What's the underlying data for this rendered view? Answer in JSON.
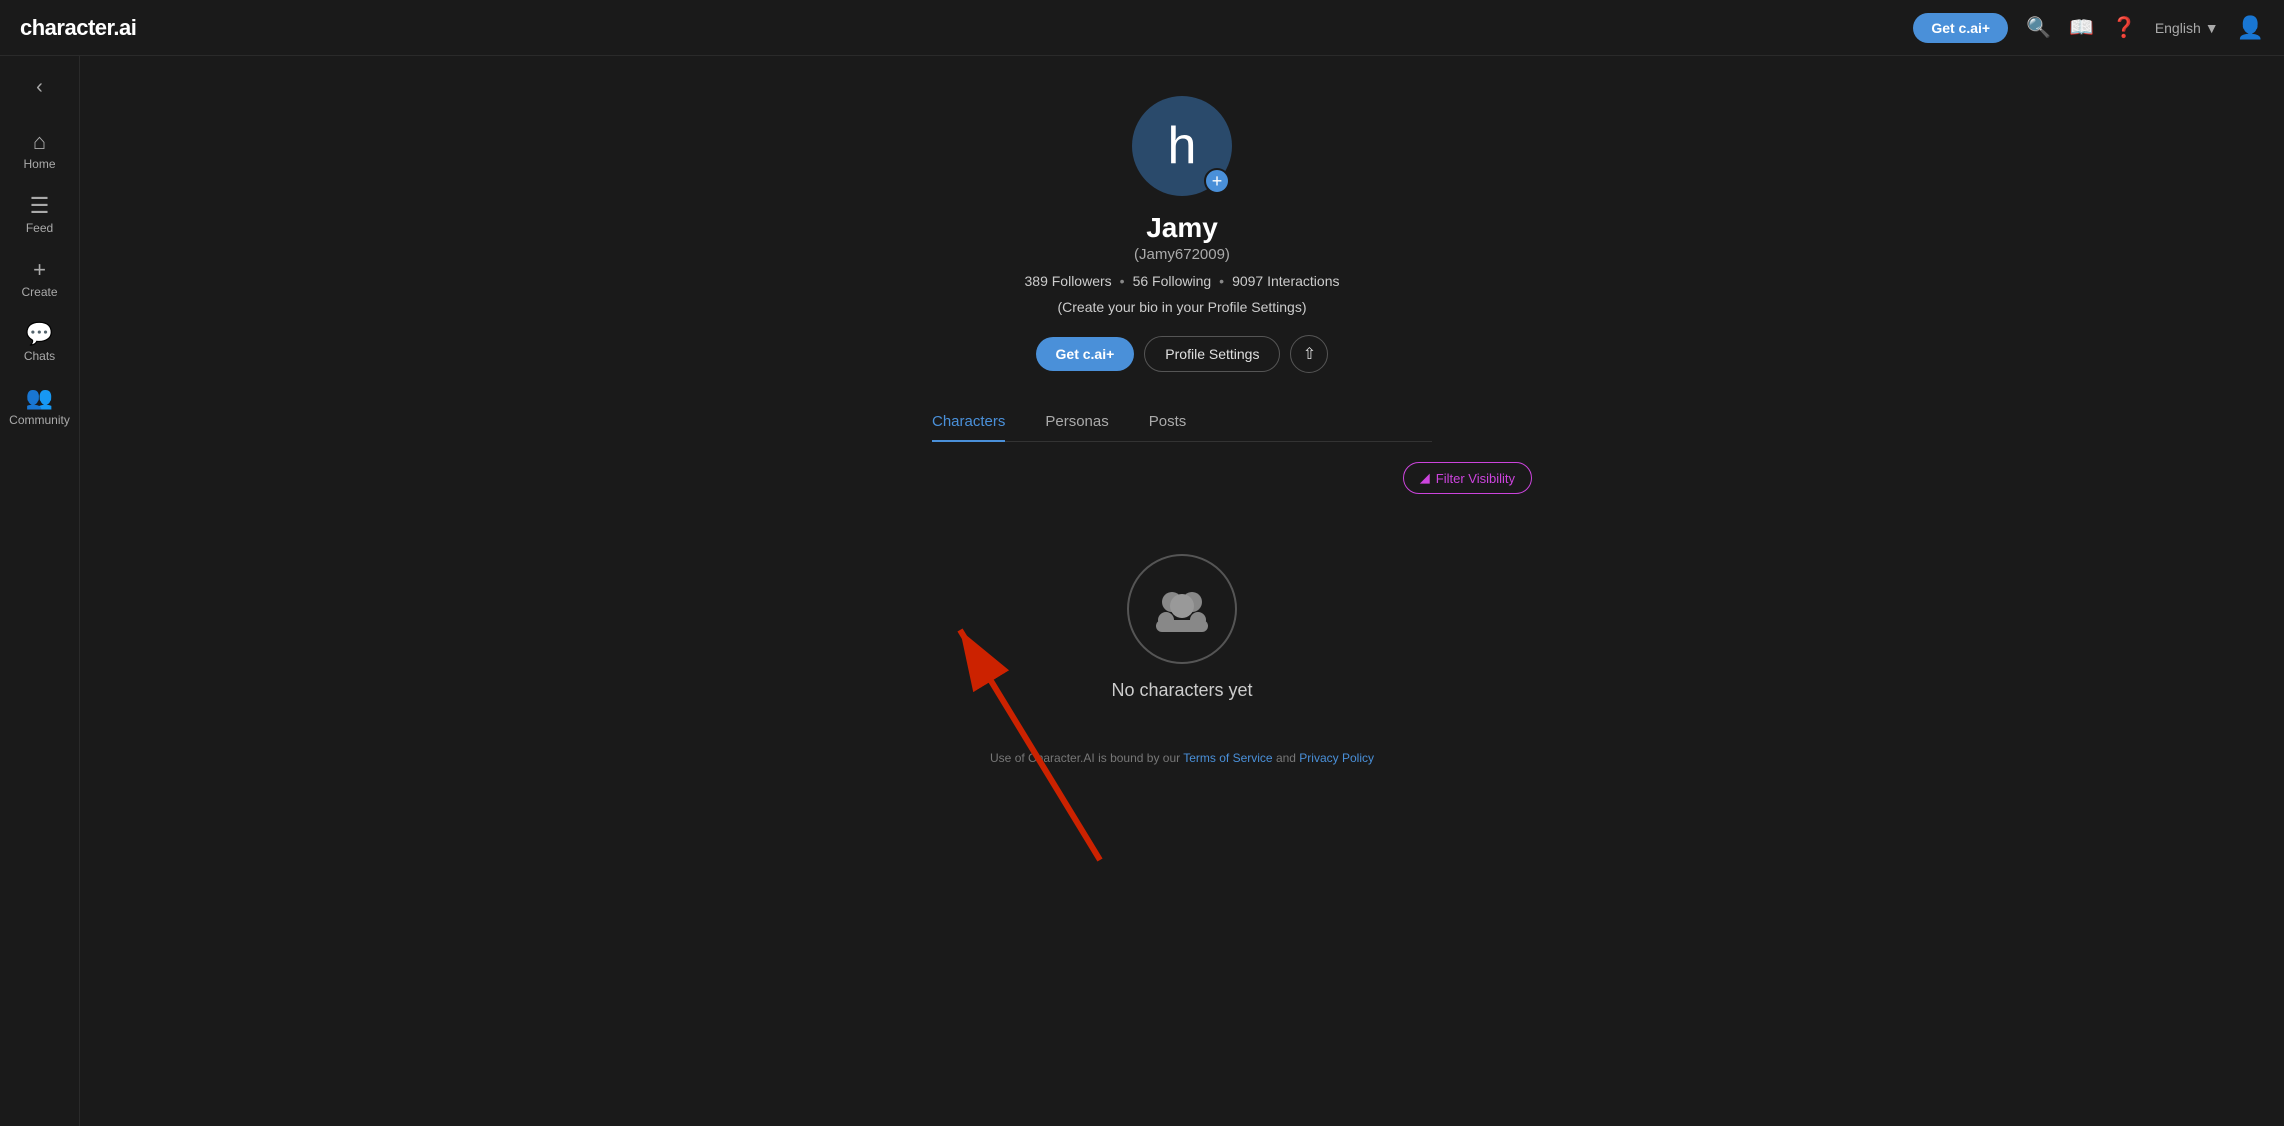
{
  "app": {
    "logo": "character.ai",
    "lang": "English"
  },
  "topnav": {
    "get_cai_label": "Get c.ai+",
    "lang_label": "English"
  },
  "sidebar": {
    "back_icon": "‹",
    "items": [
      {
        "id": "home",
        "icon": "⌂",
        "label": "Home"
      },
      {
        "id": "feed",
        "icon": "≡",
        "label": "Feed"
      },
      {
        "id": "create",
        "icon": "+",
        "label": "Create"
      },
      {
        "id": "chats",
        "icon": "💬",
        "label": "Chats"
      },
      {
        "id": "community",
        "icon": "👥",
        "label": "Community"
      }
    ]
  },
  "profile": {
    "avatar_letter": "h",
    "display_name": "Jamy",
    "username": "(Jamy672009)",
    "followers": "389 Followers",
    "following": "56 Following",
    "interactions": "9097 Interactions",
    "bio_prompt": "(Create your bio in your Profile Settings)",
    "get_cai_label": "Get c.ai+",
    "settings_label": "Profile Settings",
    "share_icon": "↑"
  },
  "tabs": [
    {
      "id": "characters",
      "label": "Characters",
      "active": true
    },
    {
      "id": "personas",
      "label": "Personas",
      "active": false
    },
    {
      "id": "posts",
      "label": "Posts",
      "active": false
    }
  ],
  "filter": {
    "label": "Filter Visibility",
    "icon": "▼"
  },
  "no_characters": {
    "text": "No characters yet"
  },
  "footer": {
    "text_before": "Use of Character.AI is bound by our ",
    "tos_label": "Terms of Service",
    "tos_url": "#",
    "and": " and ",
    "privacy_label": "Privacy Policy",
    "privacy_url": "#"
  }
}
